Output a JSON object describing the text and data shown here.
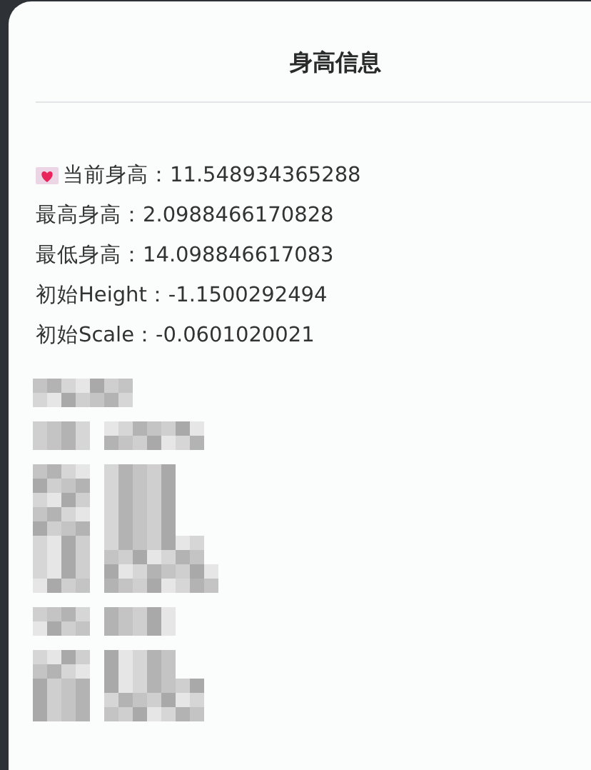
{
  "dialog": {
    "title": "身高信息",
    "lines": [
      {
        "kind": "marked",
        "text": "当前身高：11.548934365288"
      },
      {
        "kind": "plain",
        "text": "最高身高：2.0988466170828"
      },
      {
        "kind": "plain",
        "text": "最低身高：14.098846617083"
      },
      {
        "kind": "plain",
        "text": "初始Height：-1.1500292494"
      },
      {
        "kind": "plain",
        "text": "初始Scale：-0.0601020021"
      }
    ]
  }
}
